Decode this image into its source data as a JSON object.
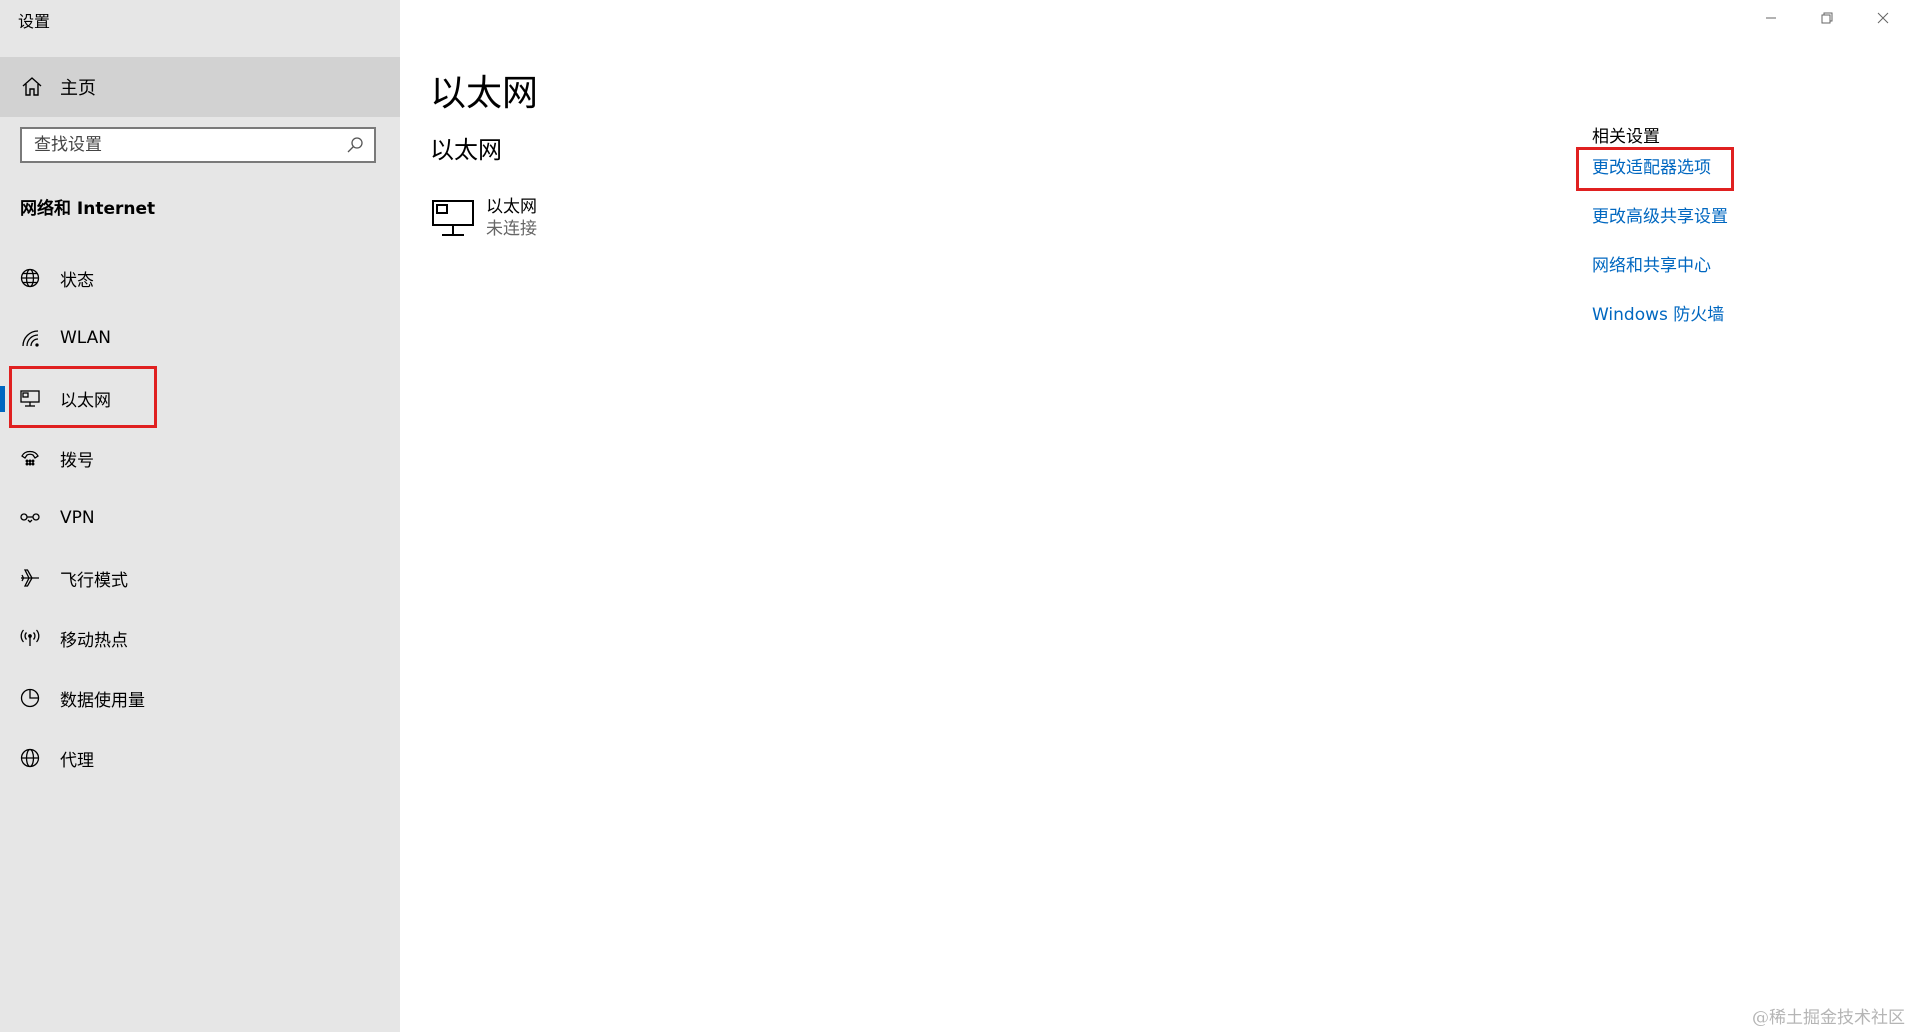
{
  "app": {
    "title": "设置"
  },
  "sidebar": {
    "home_label": "主页",
    "search_placeholder": "查找设置",
    "section_title": "网络和 Internet",
    "items": [
      {
        "label": "状态",
        "icon": "globe-status-icon"
      },
      {
        "label": "WLAN",
        "icon": "wifi-icon"
      },
      {
        "label": "以太网",
        "icon": "ethernet-icon",
        "selected": true
      },
      {
        "label": "拨号",
        "icon": "dialup-icon"
      },
      {
        "label": "VPN",
        "icon": "vpn-icon"
      },
      {
        "label": "飞行模式",
        "icon": "airplane-icon"
      },
      {
        "label": "移动热点",
        "icon": "hotspot-icon"
      },
      {
        "label": "数据使用量",
        "icon": "data-usage-icon"
      },
      {
        "label": "代理",
        "icon": "globe-icon"
      }
    ]
  },
  "main": {
    "page_title": "以太网",
    "sub_title": "以太网",
    "adapter": {
      "name": "以太网",
      "status": "未连接"
    },
    "related": {
      "header": "相关设置",
      "links": [
        "更改适配器选项",
        "更改高级共享设置",
        "网络和共享中心",
        "Windows 防火墙"
      ]
    }
  },
  "watermark": "@稀土掘金技术社区",
  "colors": {
    "accent": "#0067c0",
    "highlight": "#e02020",
    "sidebar_bg": "#e6e6e6"
  }
}
